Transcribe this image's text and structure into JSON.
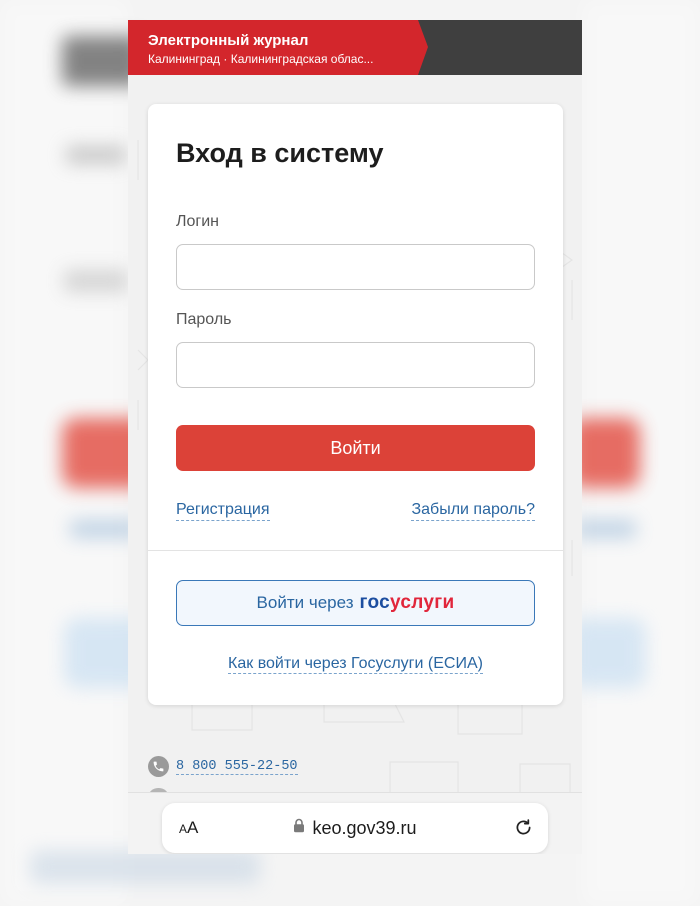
{
  "header": {
    "title": "Электронный журнал",
    "subtitle": "Калининград · Калининградская облас..."
  },
  "login_form": {
    "title": "Вход в систему",
    "login_label": "Логин",
    "login_value": "",
    "password_label": "Пароль",
    "password_value": "",
    "submit_label": "Войти",
    "register_link": "Регистрация",
    "forgot_link": "Забыли пароль?",
    "gosuslugi_prefix": "Войти через",
    "gosuslugi_brand_part1": "гос",
    "gosuslugi_brand_part2": "услуги",
    "esia_help_link": "Как войти через Госуслуги (ЕСИА)"
  },
  "contact": {
    "phone": "8 800 555-22-50"
  },
  "browser": {
    "text_size_label_small": "A",
    "text_size_label_large": "A",
    "url": "keo.gov39.ru"
  },
  "colors": {
    "header_red": "#d3262c",
    "header_dark": "#3f3f3f",
    "primary_button": "#dc4238",
    "link": "#2a66a1",
    "gosuslugi_blue": "#1c4ea0",
    "gosuslugi_red": "#e1263b"
  },
  "icons": {
    "phone": "phone-icon",
    "lock": "lock-icon",
    "reload": "reload-icon"
  }
}
